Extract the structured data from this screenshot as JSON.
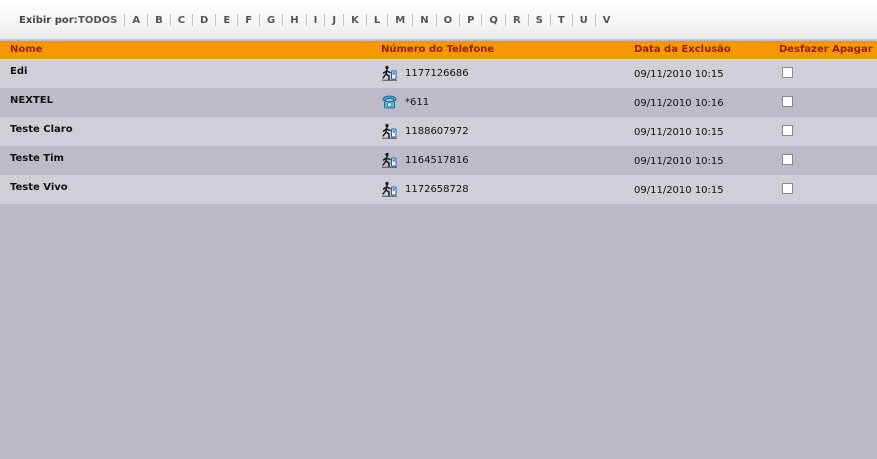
{
  "filter": {
    "label": "Exibir por:",
    "letters": [
      "TODOS",
      "A",
      "B",
      "C",
      "D",
      "E",
      "F",
      "G",
      "H",
      "I",
      "J",
      "K",
      "L",
      "M",
      "N",
      "O",
      "P",
      "Q",
      "R",
      "S",
      "T",
      "U",
      "V"
    ]
  },
  "table": {
    "headers": {
      "name": "Nome",
      "phone": "Número do Telefone",
      "date": "Data da Exclusão",
      "undo": "Desfazer Apagar"
    },
    "rows": [
      {
        "name": "Edi",
        "icon": "mobile-operator-icon",
        "phone": "1177126686",
        "date": "09/11/2010 10:15",
        "checked": false
      },
      {
        "name": "NEXTEL",
        "icon": "phone-icon",
        "phone": "*611",
        "date": "09/11/2010 10:16",
        "checked": false
      },
      {
        "name": "Teste Claro",
        "icon": "mobile-operator-icon",
        "phone": "1188607972",
        "date": "09/11/2010 10:15",
        "checked": false
      },
      {
        "name": "Teste Tim",
        "icon": "mobile-operator-icon",
        "phone": "1164517816",
        "date": "09/11/2010 10:15",
        "checked": false
      },
      {
        "name": "Teste Vivo",
        "icon": "mobile-operator-icon",
        "phone": "1172658728",
        "date": "09/11/2010 10:15",
        "checked": false
      }
    ]
  },
  "colors": {
    "header_bg": "#f39800",
    "header_text": "#9c1a0a",
    "row_light": "#d0ced9",
    "row_dark": "#bdbbc7",
    "page_bg": "#bcbac6"
  }
}
